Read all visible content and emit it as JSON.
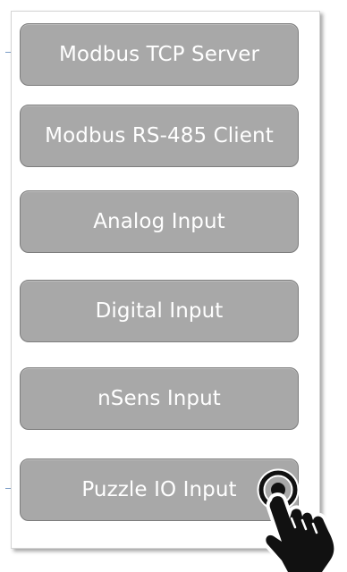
{
  "menu": {
    "items": [
      {
        "label": "Modbus TCP Server"
      },
      {
        "label": "Modbus RS-485 Client"
      },
      {
        "label": "Analog Input"
      },
      {
        "label": "Digital Input"
      },
      {
        "label": "nSens Input"
      },
      {
        "label": "Puzzle IO Input"
      }
    ]
  },
  "cursor": {
    "icon": "pointing-hand-click-icon",
    "target_item": "Puzzle IO Input"
  },
  "colors": {
    "button_fill": "#a8a8a8",
    "button_border": "#7c7c7c",
    "button_text": "#ffffff",
    "cursor_fill": "#111111"
  }
}
